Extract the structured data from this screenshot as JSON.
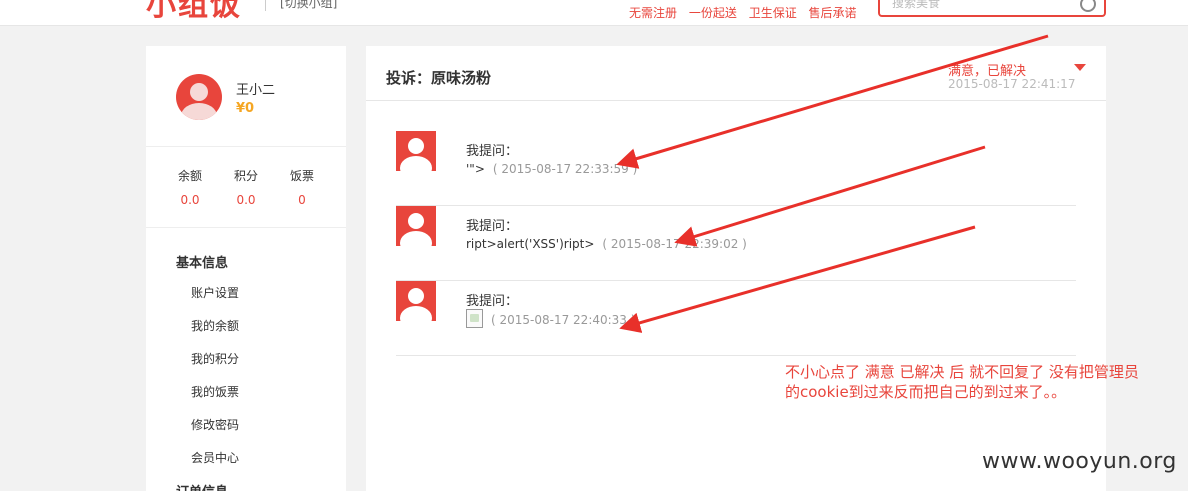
{
  "header": {
    "logo": "小组饭",
    "switch_group": "[切换小组]",
    "nav": [
      "无需注册",
      "一份起送",
      "卫生保证",
      "售后承诺"
    ],
    "search_placeholder": "搜索美食"
  },
  "sidebar": {
    "username": "王小二",
    "coins": "¥0",
    "stats": [
      {
        "label": "余额",
        "value": "0.0"
      },
      {
        "label": "积分",
        "value": "0.0"
      },
      {
        "label": "饭票",
        "value": "0"
      }
    ],
    "section_basic": "基本信息",
    "menu": [
      "账户设置",
      "我的余额",
      "我的积分",
      "我的饭票",
      "修改密码",
      "会员中心"
    ],
    "section_orders": "订单信息"
  },
  "main": {
    "title": "投诉：原味汤粉",
    "status": "满意，已解决",
    "status_time": "2015-08-17 22:41:17",
    "messages": [
      {
        "asker": "我提问：",
        "content": "'\">",
        "time": "( 2015-08-17 22:33:59 )"
      },
      {
        "asker": "我提问：",
        "content": "ript>alert('XSS')ript>",
        "time": "( 2015-08-17 22:39:02 )"
      },
      {
        "asker": "我提问：",
        "content": "",
        "time": "( 2015-08-17 22:40:33 )"
      }
    ]
  },
  "annotation": {
    "line1": "不小心点了 满意 已解决 后 就不回复了   没有把管理员",
    "line2": "的cookie到过来反而把自己的到过来了。。"
  },
  "watermark": "www.wooyun.org",
  "colors": {
    "accent": "#e8453c",
    "background": "#f2f2f2",
    "coin": "#f5a623"
  }
}
